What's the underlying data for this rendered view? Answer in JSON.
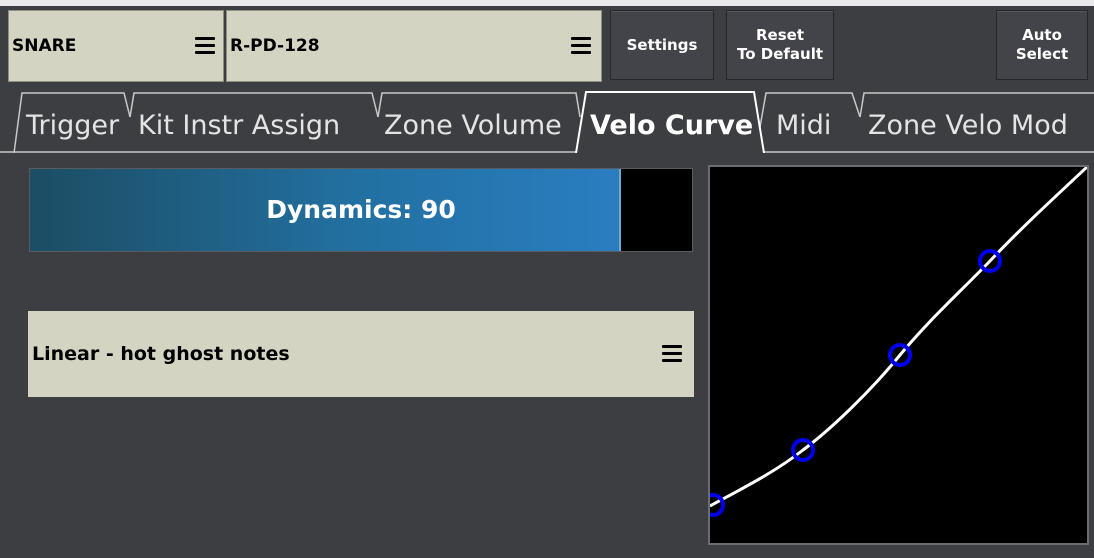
{
  "toolbar": {
    "instrument_select": "SNARE",
    "trigger_select": "R-PD-128",
    "settings_label": "Settings",
    "reset_line1": "Reset",
    "reset_line2": "To Default",
    "auto_line1": "Auto",
    "auto_line2": "Select"
  },
  "tabs": [
    {
      "label": "Trigger",
      "active": false
    },
    {
      "label": "Kit Instr Assign",
      "active": false
    },
    {
      "label": "Zone Volume",
      "active": false
    },
    {
      "label": "Velo Curve",
      "active": true
    },
    {
      "label": "Midi",
      "active": false
    },
    {
      "label": "Zone Velo Mod",
      "active": false
    }
  ],
  "dynamics": {
    "text": "Dynamics: 90",
    "level_fraction": 0.89
  },
  "curve_select": {
    "value": "Linear - hot ghost notes"
  },
  "colors": {
    "background": "#3d3e42",
    "dropdown": "#d4d4c3",
    "dynamics_fill": "#2a7ec0",
    "curve_line": "#ffffff",
    "control_point": "#0000ee"
  }
}
